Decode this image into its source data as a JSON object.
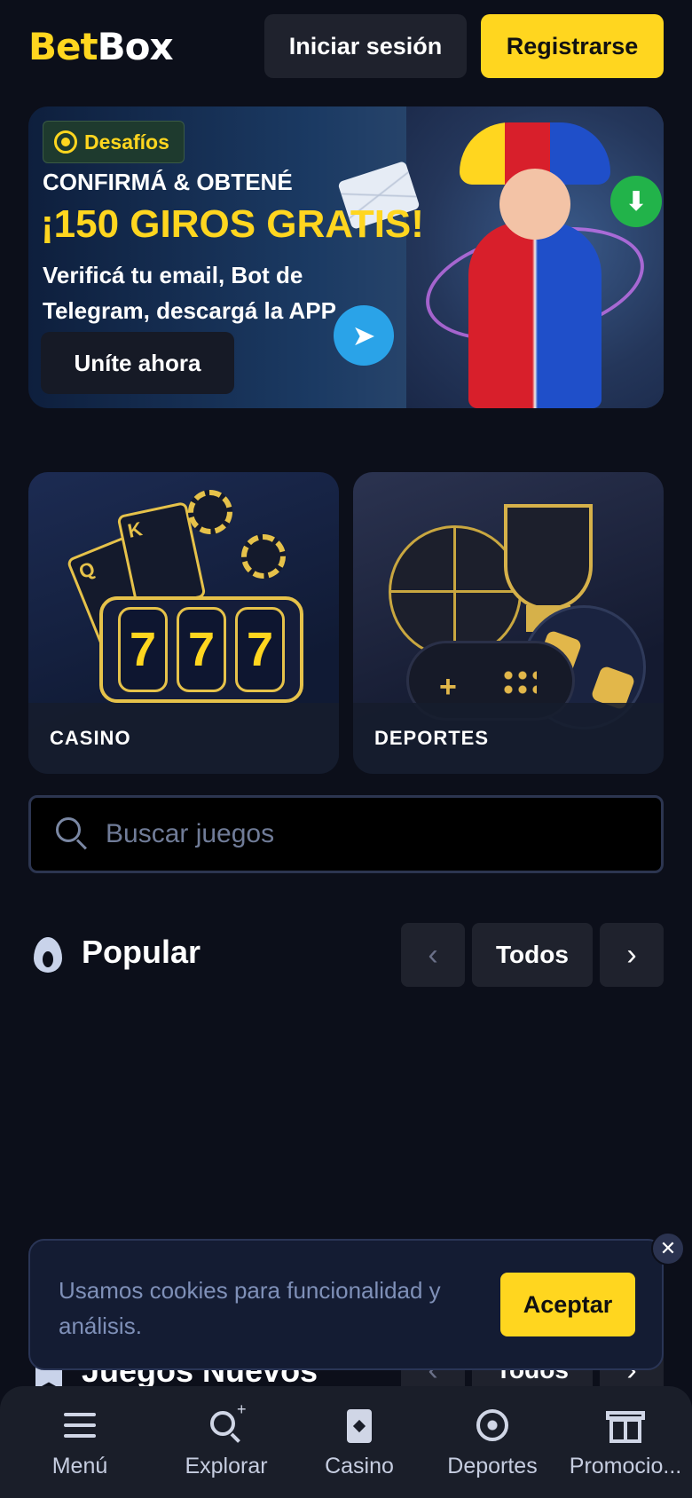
{
  "header": {
    "logo_part1": "Bet",
    "logo_part2": "Box",
    "login_label": "Iniciar sesión",
    "register_label": "Registrarse"
  },
  "banner": {
    "badge": "Desafíos",
    "kicker": "CONFIRMÁ & OBTENÉ",
    "title": "¡150 GIROS GRATIS!",
    "description": "Verificá tu email, Bot de Telegram, descargá la APP",
    "cta": "Uníte ahora"
  },
  "categories": [
    {
      "label": "CASINO"
    },
    {
      "label": "DEPORTES"
    }
  ],
  "search": {
    "placeholder": "Buscar juegos"
  },
  "popular": {
    "title": "Popular",
    "all_label": "Todos",
    "prev_glyph": "‹",
    "next_glyph": "›"
  },
  "new_games": {
    "title": "Juegos Nuevos"
  },
  "cookie": {
    "text": "Usamos cookies para funcionalidad y análisis.",
    "accept": "Aceptar",
    "close_glyph": "✕"
  },
  "bottom_nav": {
    "items": [
      {
        "label": "Menú",
        "icon": "menu-icon"
      },
      {
        "label": "Explorar",
        "icon": "explore-icon"
      },
      {
        "label": "Casino",
        "icon": "casino-icon"
      },
      {
        "label": "Deportes",
        "icon": "soccer-ball-icon"
      },
      {
        "label": "Promocio...",
        "icon": "gift-icon"
      }
    ]
  },
  "colors": {
    "accent": "#ffd61f",
    "background": "#0c0f1a",
    "panel": "#1f222d"
  }
}
